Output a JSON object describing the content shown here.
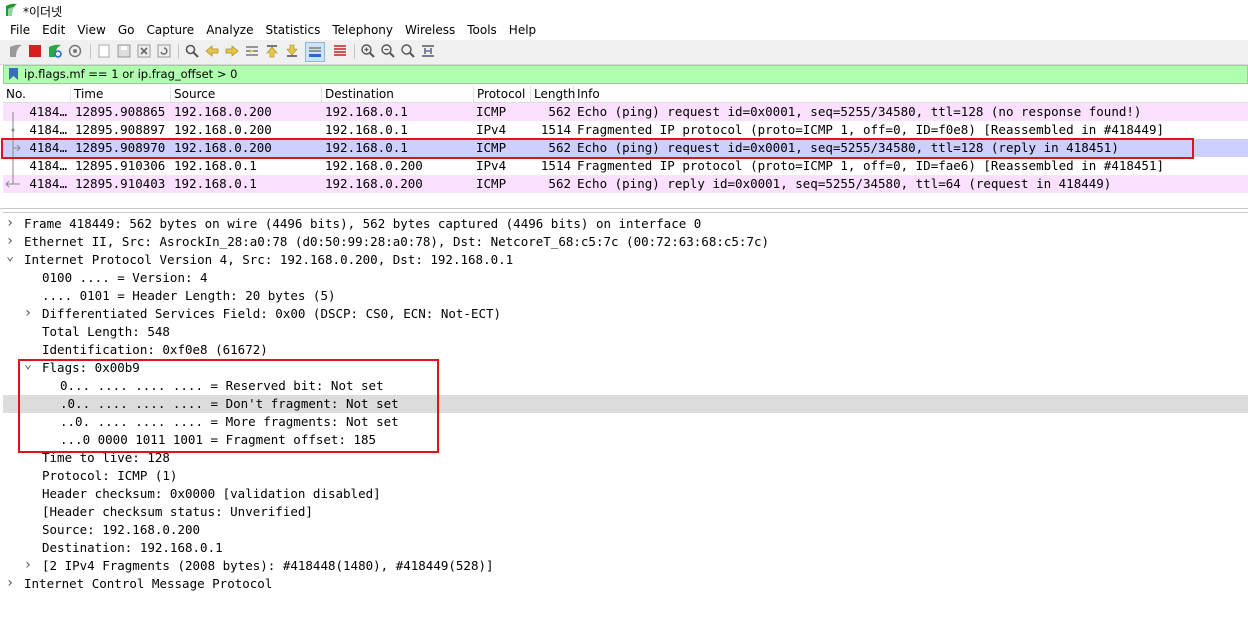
{
  "window": {
    "title": "*이더넷"
  },
  "menu": [
    "File",
    "Edit",
    "View",
    "Go",
    "Capture",
    "Analyze",
    "Statistics",
    "Telephony",
    "Wireless",
    "Tools",
    "Help"
  ],
  "filter": {
    "text": "ip.flags.mf == 1 or ip.frag_offset > 0"
  },
  "packet_list": {
    "columns": [
      "No.",
      "Time",
      "Source",
      "Destination",
      "Protocol",
      "Length",
      "Info"
    ],
    "rows": [
      {
        "no": "4184…",
        "time": "12895.908865",
        "source": "192.168.0.200",
        "destination": "192.168.0.1",
        "protocol": "ICMP",
        "length": "562",
        "info": "Echo (ping) request  id=0x0001, seq=5255/34580, ttl=128 (no response found!)",
        "kind": "icmp"
      },
      {
        "no": "4184…",
        "time": "12895.908897",
        "source": "192.168.0.200",
        "destination": "192.168.0.1",
        "protocol": "IPv4",
        "length": "1514",
        "info": "Fragmented IP protocol (proto=ICMP 1, off=0, ID=f0e8) [Reassembled in #418449]",
        "kind": "ipv4"
      },
      {
        "no": "4184…",
        "time": "12895.908970",
        "source": "192.168.0.200",
        "destination": "192.168.0.1",
        "protocol": "ICMP",
        "length": "562",
        "info": "Echo (ping) request  id=0x0001, seq=5255/34580, ttl=128 (reply in 418451)",
        "kind": "selected"
      },
      {
        "no": "4184…",
        "time": "12895.910306",
        "source": "192.168.0.1",
        "destination": "192.168.0.200",
        "protocol": "IPv4",
        "length": "1514",
        "info": "Fragmented IP protocol (proto=ICMP 1, off=0, ID=fae6) [Reassembled in #418451]",
        "kind": "ipv4"
      },
      {
        "no": "4184…",
        "time": "12895.910403",
        "source": "192.168.0.1",
        "destination": "192.168.0.200",
        "protocol": "ICMP",
        "length": "562",
        "info": "Echo (ping) reply    id=0x0001, seq=5255/34580, ttl=64 (request in 418449)",
        "kind": "icmp"
      }
    ]
  },
  "details": [
    {
      "text": "Frame 418449: 562 bytes on wire (4496 bits), 562 bytes captured (4496 bits) on interface 0",
      "arrow": ">"
    },
    {
      "text": "Ethernet II, Src: AsrockIn_28:a0:78 (d0:50:99:28:a0:78), Dst: NetcoreT_68:c5:7c (00:72:63:68:c5:7c)",
      "arrow": ">"
    },
    {
      "text": "Internet Protocol Version 4, Src: 192.168.0.200, Dst: 192.168.0.1",
      "arrow": "v"
    },
    {
      "text": "0100 .... = Version: 4",
      "arrow": ""
    },
    {
      "text": ".... 0101 = Header Length: 20 bytes (5)",
      "arrow": ""
    },
    {
      "text": "Differentiated Services Field: 0x00 (DSCP: CS0, ECN: Not-ECT)",
      "arrow": ">"
    },
    {
      "text": "Total Length: 548",
      "arrow": ""
    },
    {
      "text": "Identification: 0xf0e8 (61672)",
      "arrow": ""
    },
    {
      "text": "Flags: 0x00b9",
      "arrow": "v"
    },
    {
      "text": "0... .... .... .... = Reserved bit: Not set",
      "arrow": ""
    },
    {
      "text": ".0.. .... .... .... = Don't fragment: Not set",
      "arrow": ""
    },
    {
      "text": "..0. .... .... .... = More fragments: Not set",
      "arrow": ""
    },
    {
      "text": "...0 0000 1011 1001 = Fragment offset: 185",
      "arrow": ""
    },
    {
      "text": "Time to live: 128",
      "arrow": ""
    },
    {
      "text": "Protocol: ICMP (1)",
      "arrow": ""
    },
    {
      "text": "Header checksum: 0x0000 [validation disabled]",
      "arrow": ""
    },
    {
      "text": "[Header checksum status: Unverified]",
      "arrow": ""
    },
    {
      "text": "Source: 192.168.0.200",
      "arrow": ""
    },
    {
      "text": "Destination: 192.168.0.1",
      "arrow": ""
    },
    {
      "text": "[2 IPv4 Fragments (2008 bytes): #418448(1480), #418449(528)]",
      "arrow": ">"
    },
    {
      "text": "Internet Control Message Protocol",
      "arrow": ">"
    }
  ],
  "colors": {
    "icmp_row": "#fce0ff",
    "selected_row": "#cccfff",
    "filter_bg": "#afffaf",
    "annotation_red": "#e0121b",
    "highlight_row": "#dcdcdc"
  }
}
